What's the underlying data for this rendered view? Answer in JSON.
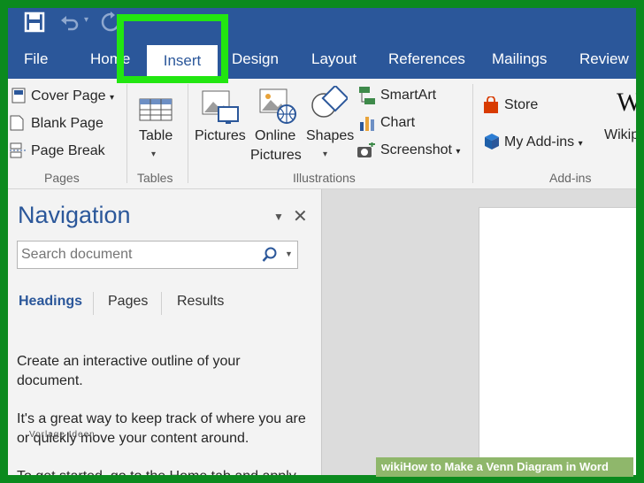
{
  "tabs": [
    "File",
    "Home",
    "Insert",
    "Design",
    "Layout",
    "References",
    "Mailings",
    "Review"
  ],
  "active_tab": "Insert",
  "ribbon": {
    "pages": {
      "cover_page": "Cover Page",
      "blank_page": "Blank Page",
      "page_break": "Page Break",
      "group_label": "Pages"
    },
    "tables": {
      "table": "Table",
      "group_label": "Tables"
    },
    "illustrations": {
      "pictures": "Pictures",
      "online_pictures_line1": "Online",
      "online_pictures_line2": "Pictures",
      "shapes": "Shapes",
      "smartart": "SmartArt",
      "chart": "Chart",
      "screenshot": "Screenshot",
      "group_label": "Illustrations"
    },
    "addins": {
      "store": "Store",
      "my_addins": "My Add-ins",
      "wiki": "Wikip",
      "group_label": "Add-ins"
    }
  },
  "navigation": {
    "title": "Navigation",
    "search_placeholder": "Search document",
    "tabs": [
      "Headings",
      "Pages",
      "Results"
    ],
    "body_lines": [
      "Create an interactive outline of your",
      "document.",
      "It's a great way to keep track of where you are",
      "or quickly move your content around.",
      "To get started, go to the Home tab and apply"
    ]
  },
  "watermark": "Vorlage Ideen",
  "banner": "wikiHow to Make a Venn Diagram in Word",
  "colors": {
    "word_blue": "#2b579a",
    "highlight_green": "#22e611",
    "outer_green": "#0b8a1e"
  },
  "icons": {
    "qat": [
      "save-icon",
      "undo-icon",
      "redo-icon"
    ],
    "ribbon": [
      "cover-page-icon",
      "blank-page-icon",
      "page-break-icon",
      "table-icon",
      "pictures-icon",
      "online-pictures-icon",
      "shapes-icon",
      "smartart-icon",
      "chart-icon",
      "screenshot-icon",
      "store-icon",
      "my-addins-icon",
      "wikipedia-icon"
    ]
  }
}
